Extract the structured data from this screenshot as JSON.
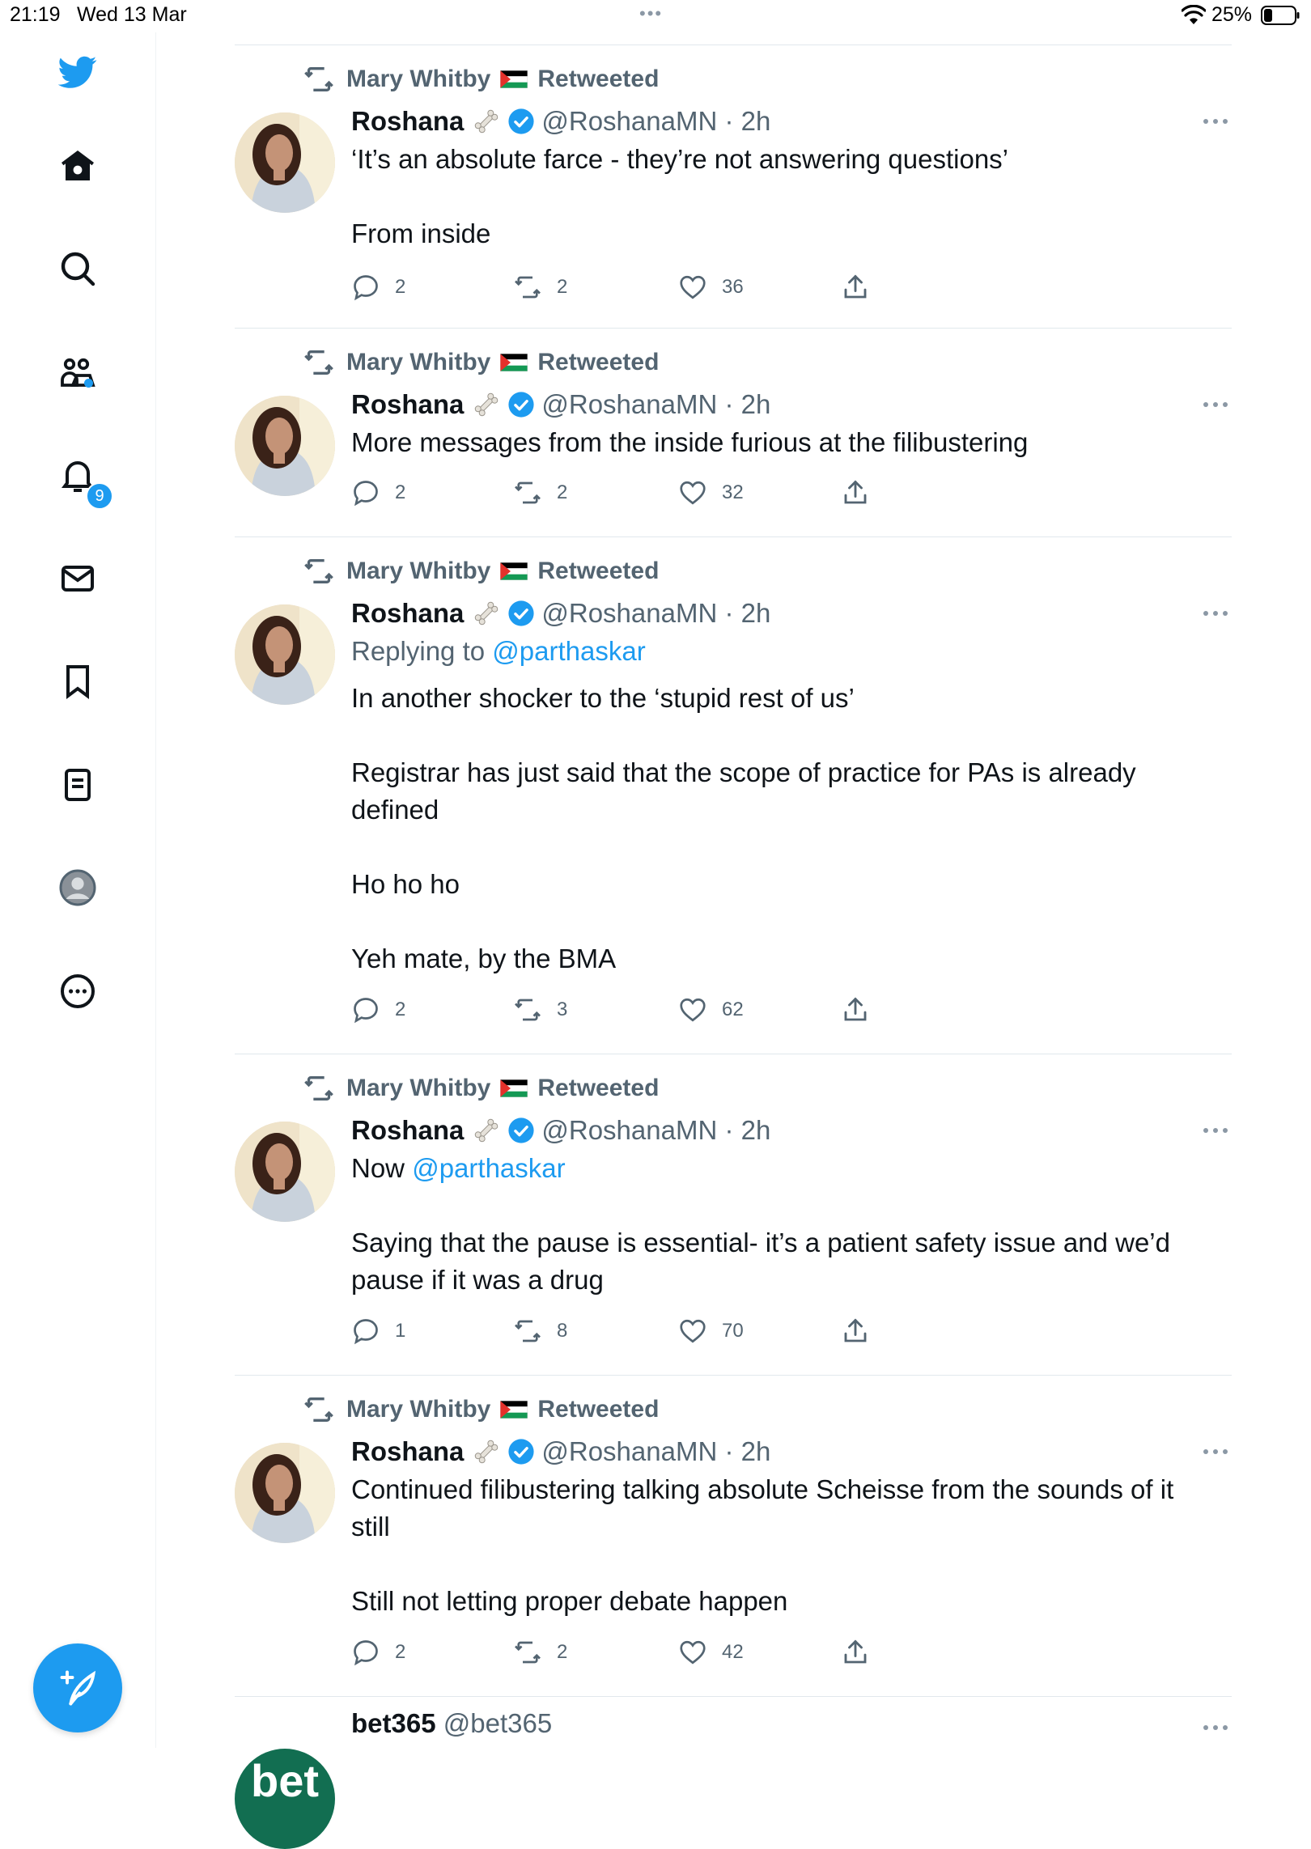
{
  "status_bar": {
    "time": "21:19",
    "date": "Wed 13 Mar",
    "dots": "•••",
    "battery": "25%"
  },
  "nav": {
    "notification_count": "9"
  },
  "tweets": [
    {
      "retweeted_by": "Mary Whitby",
      "retweeted_label": "Retweeted",
      "name": "Roshana",
      "handle": "@RoshanaMN · 2h",
      "reply_prefix": "",
      "reply_link": "",
      "lines": [
        "‘It’s an absolute farce - they’re not answering questions’",
        "",
        "From inside"
      ],
      "replies": "2",
      "retweets": "2",
      "likes": "36"
    },
    {
      "retweeted_by": "Mary Whitby",
      "retweeted_label": "Retweeted",
      "name": "Roshana",
      "handle": "@RoshanaMN · 2h",
      "reply_prefix": "",
      "reply_link": "",
      "lines": [
        "More messages from the inside furious at the filibustering"
      ],
      "replies": "2",
      "retweets": "2",
      "likes": "32"
    },
    {
      "retweeted_by": "Mary Whitby",
      "retweeted_label": "Retweeted",
      "name": "Roshana",
      "handle": "@RoshanaMN · 2h",
      "reply_prefix": "Replying to",
      "reply_link": "@parthaskar",
      "lines": [
        "In another shocker to the ‘stupid rest of us’",
        "",
        "Registrar has just said that the scope of practice for PAs is already defined",
        "",
        "Ho ho ho",
        "",
        "Yeh mate, by the BMA"
      ],
      "replies": "2",
      "retweets": "3",
      "likes": "62"
    },
    {
      "retweeted_by": "Mary Whitby",
      "retweeted_label": "Retweeted",
      "name": "Roshana",
      "handle": "@RoshanaMN · 2h",
      "reply_prefix": "",
      "reply_link": "",
      "first_prefix": "Now",
      "first_link": "@parthaskar",
      "lines": [
        "",
        "Saying that the pause is essential- it’s a patient safety issue and we’d pause if it was a drug"
      ],
      "replies": "1",
      "retweets": "8",
      "likes": "70"
    },
    {
      "retweeted_by": "Mary Whitby",
      "retweeted_label": "Retweeted",
      "name": "Roshana",
      "handle": "@RoshanaMN · 2h",
      "reply_prefix": "",
      "reply_link": "",
      "lines": [
        "Continued filibustering talking absolute Scheisse from the sounds of it still",
        "",
        "Still not letting proper debate happen"
      ],
      "replies": "2",
      "retweets": "2",
      "likes": "42"
    }
  ],
  "ad": {
    "name": "bet365",
    "handle": "@bet365",
    "avatar_text": "bet"
  },
  "colors": {
    "accent": "#1d9bf0",
    "text": "#0f1419",
    "secondary": "#536471",
    "divider": "#e1e8ed"
  }
}
